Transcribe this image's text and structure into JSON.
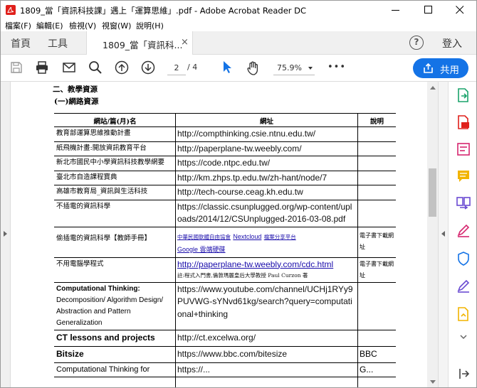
{
  "window": {
    "title": "1809_當「資訊科技課」遇上「運算思維」.pdf - Adobe Acrobat Reader DC"
  },
  "menu": [
    "檔案(F)",
    "編輯(E)",
    "檢視(V)",
    "視窗(W)",
    "說明(H)"
  ],
  "tabs": {
    "home": "首頁",
    "tools": "工具",
    "document": "1809_當「資訊科...",
    "close": "×",
    "login": "登入",
    "help": "?"
  },
  "toolbar": {
    "current_page": "2",
    "total_pages": "/ 4",
    "zoom": "75.9%",
    "share_label": "共用",
    "more": "•••"
  },
  "document": {
    "heading1": "二、教學資源",
    "heading2": "(一)網路資源",
    "columns": [
      "網站/篇(月)名",
      "網址",
      "說明"
    ],
    "rows": [
      {
        "name": "教育部運算思維推動計畫",
        "url": "http://compthinking.csie.ntnu.edu.tw/",
        "note": ""
      },
      {
        "name": "紙飛機計畫:開放資訊教育平台",
        "url": "http://paperplane-tw.weebly.com/",
        "note": ""
      },
      {
        "name": "新北市國民中小學資訊科技教學網要",
        "url": "https://code.ntpc.edu.tw/",
        "note": ""
      },
      {
        "name": "臺北市自造課程寶典",
        "url": "http://km.zhps.tp.edu.tw/zh-hant/node/7",
        "note": ""
      },
      {
        "name": "高雄市教育局_資訊與生活科技",
        "url": "http://tech-course.ceag.kh.edu.tw",
        "note": ""
      },
      {
        "name": "不插電的資訊科學",
        "url": "https://classic.csunplugged.org/wp-content/uploads/2014/12/CSUnplugged-2016-03-08.pdf",
        "note": ""
      },
      {
        "name": "偷插電的資訊科學【教師手冊】",
        "url_a": "中華民國軟體自由協會",
        "url_b": "Nextcloud",
        "url_c": "檔案分享平台",
        "url_d": "Google 雲端硬碟",
        "note": "電子書下載網址"
      },
      {
        "name": "不用電腦學程式",
        "url": "http://paperplane-tw.weebly.com/cdc.html",
        "url_note": "註:程式入門書,倫敦瑪麗皇后大學教授 Paul Curzon 著",
        "note": "電子書下載網址"
      },
      {
        "name_title": "Computational Thinking:",
        "name_rest": "Decomposition/ Algorithm Design/ Abstraction and Pattern Generalization",
        "url": "https://www.youtube.com/channel/UCHj1RYy9PUVWG-sYNvd61kg/search?query=computational+thinking",
        "note": ""
      },
      {
        "name": "CT lessons and projects",
        "url": "http://ct.excelwa.org/",
        "note": ""
      },
      {
        "name": "Bitsize",
        "url": "https://www.bbc.com/bitesize",
        "note": "BBC"
      },
      {
        "name": "Computational Thinking for",
        "url": "https://...",
        "note": "G..."
      }
    ]
  },
  "colors": {
    "accent": "#1473e6",
    "link": "#1a0dab",
    "pdf_red": "#e0201b"
  }
}
